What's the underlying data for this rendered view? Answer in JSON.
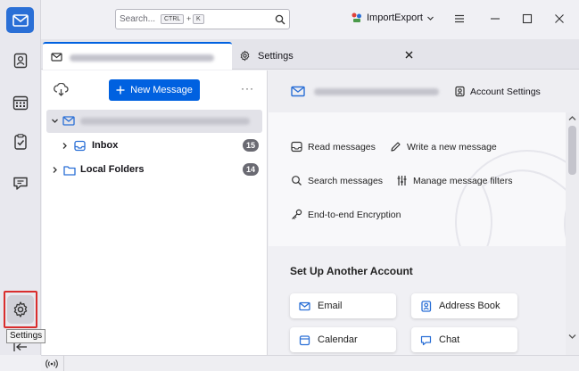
{
  "search": {
    "placeholder": "Search...",
    "kbd_ctrl": "CTRL",
    "kbd_plus": "+",
    "kbd_k": "K"
  },
  "titlebar": {
    "import_export": "ImportExport"
  },
  "tabs": [
    {
      "label": ""
    },
    {
      "label": "Settings"
    }
  ],
  "folder_pane": {
    "new_message": "New Message",
    "more": "···",
    "inbox_label": "Inbox",
    "inbox_count": "15",
    "local_folders_label": "Local Folders",
    "local_folders_count": "14"
  },
  "content": {
    "account_settings": "Account Settings",
    "actions": {
      "read": "Read messages",
      "write": "Write a new message",
      "search": "Search messages",
      "filters": "Manage message filters",
      "e2e": "End-to-end Encryption"
    },
    "setup_title": "Set Up Another Account",
    "setup_cards": {
      "email": "Email",
      "address_book": "Address Book",
      "calendar": "Calendar",
      "chat": "Chat"
    }
  },
  "tooltip": "Settings",
  "colors": {
    "accent": "#0061e0",
    "highlight_border": "#d92d2d"
  }
}
